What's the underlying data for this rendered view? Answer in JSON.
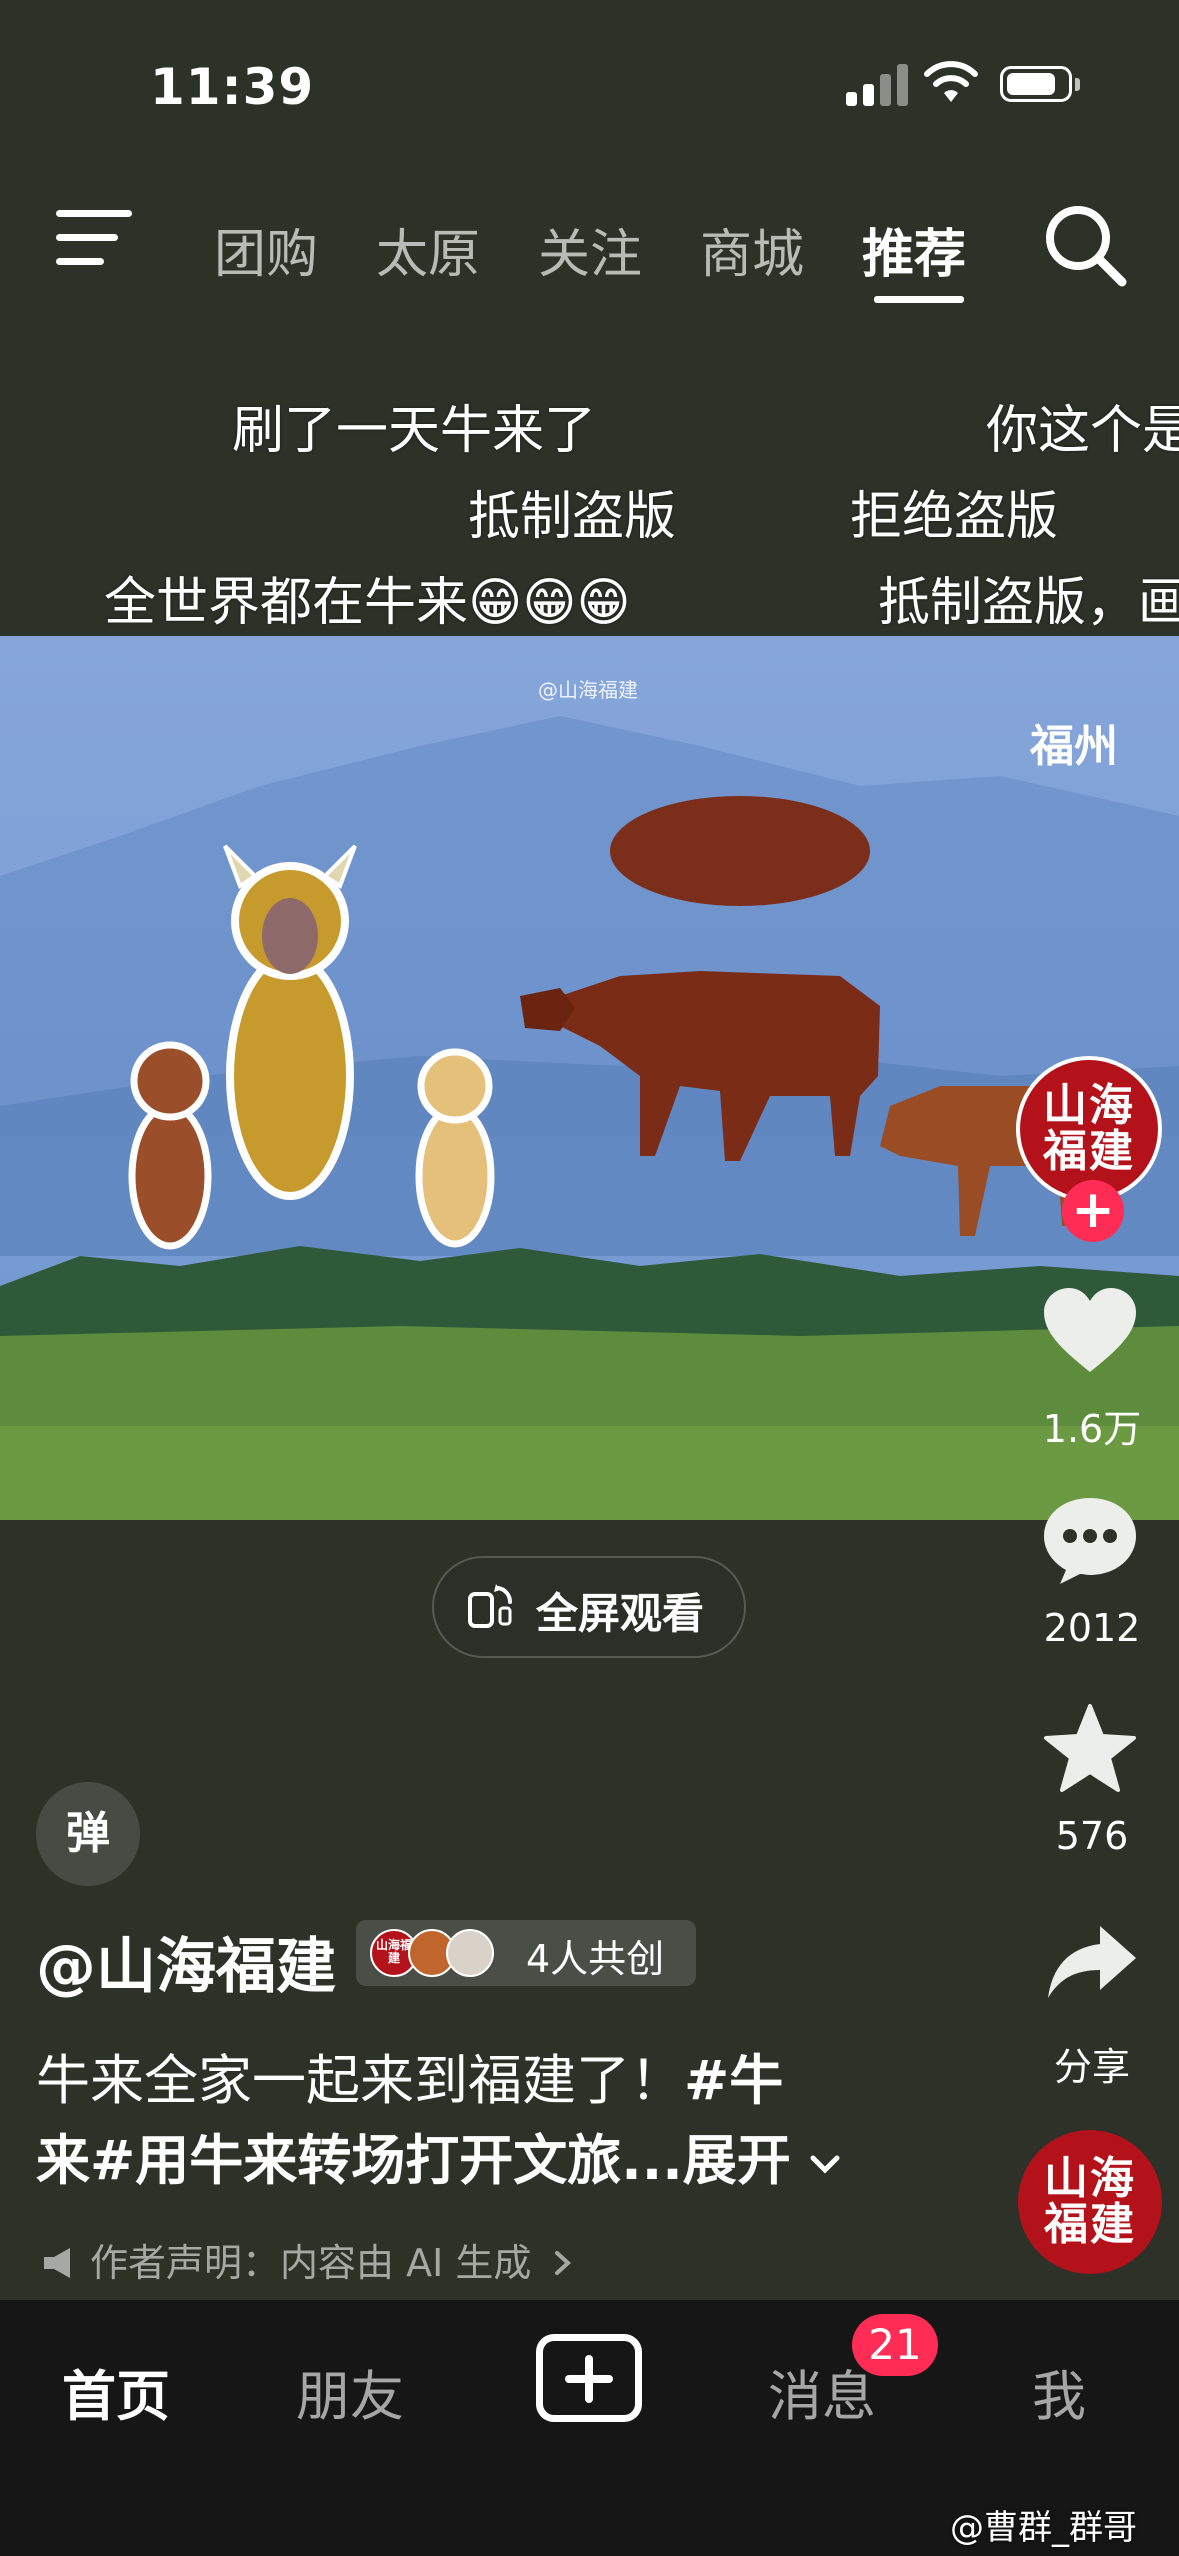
{
  "status_bar": {
    "time": "11:39"
  },
  "top_nav": {
    "tabs": [
      {
        "label": "团购",
        "active": false
      },
      {
        "label": "太原",
        "active": false
      },
      {
        "label": "关注",
        "active": false
      },
      {
        "label": "商城",
        "active": false
      },
      {
        "label": "推荐",
        "active": true
      }
    ]
  },
  "danmaku": [
    "刷了一天牛来了",
    "你这个是",
    "抵制盗版",
    "拒绝盗版",
    "全世界都在牛来😁😁😁",
    "抵制盗版，画"
  ],
  "video": {
    "watermark": "@山海福建",
    "location": "福州",
    "fullscreen_label": "全屏观看"
  },
  "actions": {
    "avatar_text": [
      "山海",
      "福建"
    ],
    "likes": "1.6万",
    "comments": "2012",
    "favorites": "576",
    "share_label": "分享",
    "music_avatar_text": [
      "山海",
      "福建"
    ]
  },
  "post": {
    "danmaku_toggle": "弹",
    "author": "@山海福建",
    "cocreate_avatar_text": "山海福建",
    "cocreate_label": "4人共创",
    "caption_line1_text": "牛来全家一起来到福建了！",
    "caption_line1_tag": "#牛",
    "caption_line2_tag": "来#用牛来转场打开文旅...",
    "expand_label": "展开",
    "ai_notice": "作者声明：内容由 AI 生成"
  },
  "bottom_tabs": {
    "home": "首页",
    "friends": "朋友",
    "messages": "消息",
    "messages_badge": "21",
    "me": "我"
  },
  "overlay_watermark": "@曹群_群哥",
  "colors": {
    "accent": "#ff2c55",
    "brand_red": "#b3121b",
    "background": "#2d3128"
  }
}
